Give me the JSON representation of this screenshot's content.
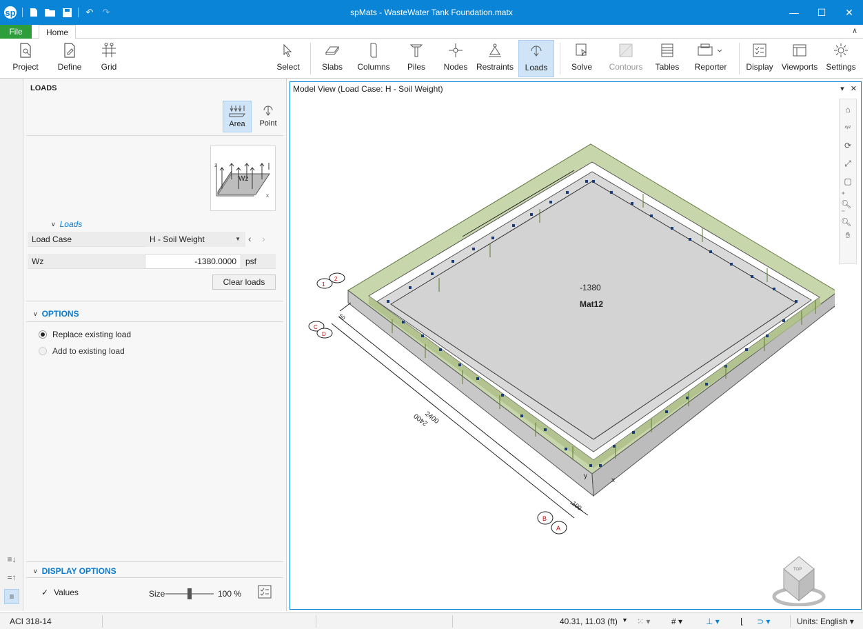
{
  "app": {
    "title": "spMats - WasteWater Tank Foundation.matx",
    "logo": "sp"
  },
  "tabs": {
    "file": "File",
    "home": "Home"
  },
  "ribbon": {
    "project": "Project",
    "define": "Define",
    "grid": "Grid",
    "select": "Select",
    "slabs": "Slabs",
    "columns": "Columns",
    "piles": "Piles",
    "nodes": "Nodes",
    "restraints": "Restraints",
    "loads": "Loads",
    "solve": "Solve",
    "contours": "Contours",
    "tables": "Tables",
    "reporter": "Reporter",
    "display": "Display",
    "viewports": "Viewports",
    "settings": "Settings"
  },
  "panel": {
    "header": "LOADS",
    "type_area": "Area",
    "type_point": "Point",
    "diagram_label": "Wz",
    "diagram_axis_z": "z",
    "diagram_axis_x": "x",
    "loads_section": "Loads",
    "load_case_label": "Load Case",
    "load_case_value": "H - Soil Weight",
    "wz_label": "Wz",
    "wz_value": "-1380.0000",
    "wz_unit": "psf",
    "clear_loads": "Clear loads",
    "options_title": "OPTIONS",
    "option_replace": "Replace existing load",
    "option_add": "Add to existing load",
    "display_options_title": "DISPLAY OPTIONS",
    "values_label": "Values",
    "size_label": "Size",
    "size_value": "100 %",
    "size_fraction": 0.5
  },
  "model_view": {
    "title": "Model View (Load Case: H - Soil Weight)",
    "load_value": "-1380",
    "material": "Mat12",
    "dim_long": "2400",
    "dim_short": "100",
    "dim_mid": "50",
    "grid_labels": [
      "1",
      "2",
      "C",
      "D",
      "B",
      "A"
    ],
    "cube_face": "TOP"
  },
  "status": {
    "code": "ACI 318-14",
    "coords": "40.31, 11.03 (ft)",
    "units": "Units: English"
  }
}
